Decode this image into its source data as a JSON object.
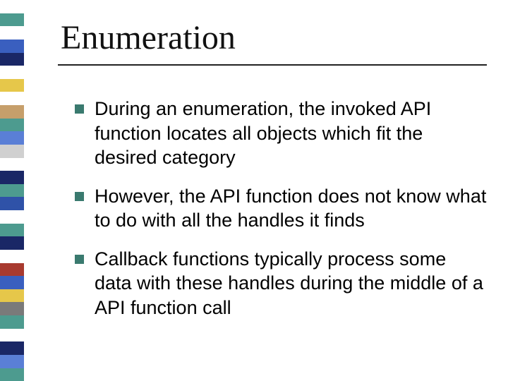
{
  "title": "Enumeration",
  "bullets": [
    "During an enumeration, the invoked API function locates all objects which fit the desired category",
    "However, the API function does not know what to do with all the handles it finds",
    "Callback functions typically process some data with these handles during the middle of a API function call"
  ]
}
